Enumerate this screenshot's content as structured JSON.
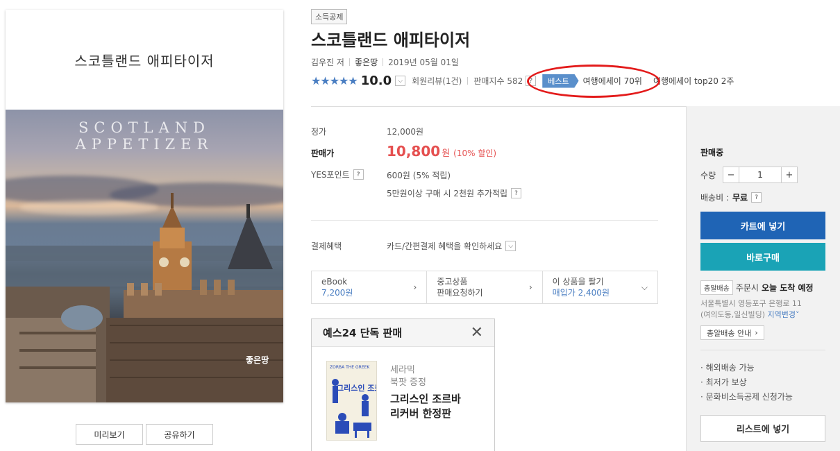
{
  "cover": {
    "korean_title": "스코틀랜드 애피타이저",
    "english_title": "SCOTLAND APPETIZER",
    "publisher_mark": "좋은땅"
  },
  "cover_buttons": {
    "preview": "미리보기",
    "share": "공유하기"
  },
  "product": {
    "tag": "소득공제",
    "title": "스코틀랜드 애피타이저",
    "author": "김우진 저",
    "publisher": "좋은땅",
    "date": "2019년 05월 01일",
    "stars": "★★★★★",
    "score": "10.0",
    "reviews": "회원리뷰(1건)",
    "sales_index": "판매지수 582",
    "best_tag": "베스트",
    "best_rank": "여행에세이 70위",
    "top20": "여행에세이 top20 2주"
  },
  "price": {
    "list_label": "정가",
    "list_value": "12,000원",
    "sale_label": "판매가",
    "sale_value": "10,800",
    "sale_won": "원",
    "sale_discount": "(10% 할인)",
    "point_label": "YES포인트",
    "point_value": "600원 (5% 적립)",
    "extra_point": "5만원이상 구매 시 2천원 추가적립",
    "pay_label": "결제혜택",
    "pay_value": "카드/간편결제 혜택을 확인하세요"
  },
  "options": [
    {
      "line1": "eBook",
      "line2": "7,200원"
    },
    {
      "line1": "중고상품",
      "line2": "판매요청하기"
    },
    {
      "line1": "이 상품을 팔기",
      "line2": "매입가 2,400원"
    }
  ],
  "exclusive": {
    "title": "예스24 단독 판매",
    "sub1": "세라믹",
    "sub2": "북팟 증정",
    "name1": "그리스인 조르바",
    "name2": "리커버 한정판",
    "cover_top": "ZORBA THE GREEK",
    "cover_big": "그리스인 조르바"
  },
  "panel": {
    "status": "판매중",
    "qty_label": "수량",
    "qty_minus": "−",
    "qty_value": "1",
    "qty_plus": "+",
    "ship_label": "배송비 :",
    "ship_value": "무료",
    "cart_button": "카트에 넣기",
    "buy_button": "바로구매",
    "dawn_badge": "총알배송",
    "dawn_text": "주문시",
    "dawn_bold": "오늘 도착 예정",
    "addr1": "서울특별시 영등포구 은행로 11",
    "addr2": "(여의도동,일신빌딩)",
    "addr_link": "지역변경",
    "dawn_info": "총알배송 안내",
    "bullets": [
      "· 해외배송 가능",
      "· 최저가 보상",
      "· 문화비소득공제 신청가능"
    ],
    "list_button": "리스트에 넣기"
  },
  "colors": {
    "sale_red": "#e55050",
    "cart_blue": "#1f64b5",
    "buy_teal": "#1aa3b6",
    "best_blue": "#5a8fcb",
    "annotation_red": "#e31b1b"
  }
}
